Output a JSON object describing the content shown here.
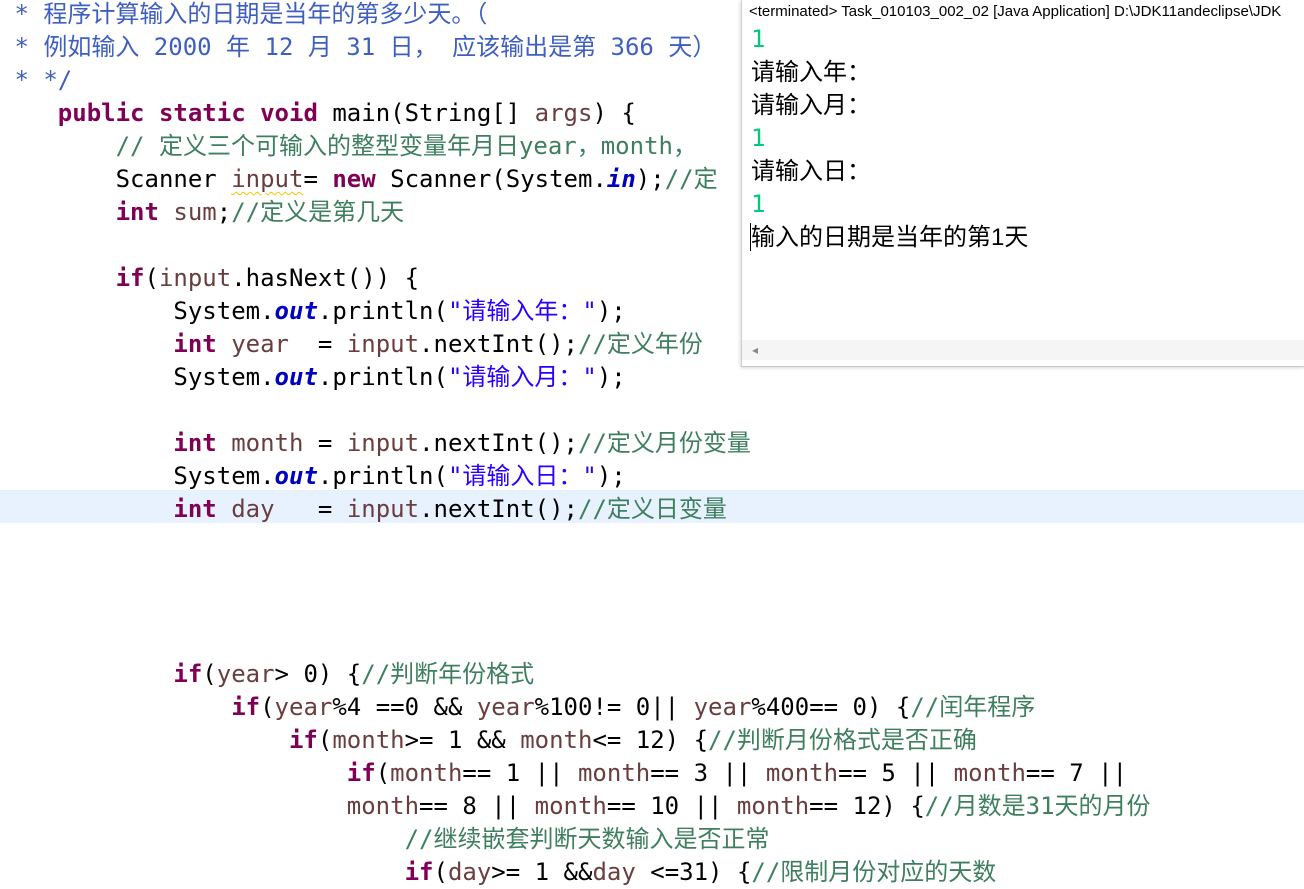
{
  "editor": {
    "lines": [
      [
        {
          "t": " * 程序计算输入的日期是当年的第多少天。（",
          "c": "javadoc"
        }
      ],
      [
        {
          "t": " * 例如输入 2000 年 12 月 31 日， 应该输出是第 366 天）",
          "c": "javadoc"
        }
      ],
      [
        {
          "t": " * */",
          "c": "javadoc"
        }
      ],
      [
        {
          "t": "    ",
          "c": ""
        },
        {
          "t": "public",
          "c": "keyword"
        },
        {
          "t": " ",
          "c": ""
        },
        {
          "t": "static",
          "c": "keyword"
        },
        {
          "t": " ",
          "c": ""
        },
        {
          "t": "void",
          "c": "keyword"
        },
        {
          "t": " main(String[] ",
          "c": ""
        },
        {
          "t": "args",
          "c": "local"
        },
        {
          "t": ") {",
          "c": ""
        }
      ],
      [
        {
          "t": "        ",
          "c": ""
        },
        {
          "t": "// 定义三个可输入的整型变量年月日year，month，",
          "c": "comment"
        }
      ],
      [
        {
          "t": "        Scanner ",
          "c": ""
        },
        {
          "t": "input",
          "c": "local warn"
        },
        {
          "t": "= ",
          "c": ""
        },
        {
          "t": "new",
          "c": "keyword"
        },
        {
          "t": " Scanner(System.",
          "c": ""
        },
        {
          "t": "in",
          "c": "field"
        },
        {
          "t": ");",
          "c": ""
        },
        {
          "t": "//定",
          "c": "comment"
        }
      ],
      [
        {
          "t": "        ",
          "c": ""
        },
        {
          "t": "int",
          "c": "keyword"
        },
        {
          "t": " ",
          "c": ""
        },
        {
          "t": "sum",
          "c": "local"
        },
        {
          "t": ";",
          "c": ""
        },
        {
          "t": "//定义是第几天",
          "c": "comment"
        }
      ],
      [
        {
          "t": "",
          "c": ""
        }
      ],
      [
        {
          "t": "        ",
          "c": ""
        },
        {
          "t": "if",
          "c": "keyword"
        },
        {
          "t": "(",
          "c": ""
        },
        {
          "t": "input",
          "c": "local"
        },
        {
          "t": ".hasNext()) {",
          "c": ""
        }
      ],
      [
        {
          "t": "            System.",
          "c": ""
        },
        {
          "t": "out",
          "c": "field"
        },
        {
          "t": ".println(",
          "c": ""
        },
        {
          "t": "\"请输入年：\"",
          "c": "string"
        },
        {
          "t": ");",
          "c": ""
        }
      ],
      [
        {
          "t": "            ",
          "c": ""
        },
        {
          "t": "int",
          "c": "keyword"
        },
        {
          "t": " ",
          "c": ""
        },
        {
          "t": "year",
          "c": "local"
        },
        {
          "t": "  = ",
          "c": ""
        },
        {
          "t": "input",
          "c": "local"
        },
        {
          "t": ".nextInt();",
          "c": ""
        },
        {
          "t": "//定义年份",
          "c": "comment"
        }
      ],
      [
        {
          "t": "            System.",
          "c": ""
        },
        {
          "t": "out",
          "c": "field"
        },
        {
          "t": ".println(",
          "c": ""
        },
        {
          "t": "\"请输入月：\"",
          "c": "string"
        },
        {
          "t": ");",
          "c": ""
        }
      ],
      [
        {
          "t": "",
          "c": ""
        }
      ],
      [
        {
          "t": "            ",
          "c": ""
        },
        {
          "t": "int",
          "c": "keyword"
        },
        {
          "t": " ",
          "c": ""
        },
        {
          "t": "month",
          "c": "local"
        },
        {
          "t": " = ",
          "c": ""
        },
        {
          "t": "input",
          "c": "local"
        },
        {
          "t": ".nextInt();",
          "c": ""
        },
        {
          "t": "//定义月份变量",
          "c": "comment"
        }
      ],
      [
        {
          "t": "            System.",
          "c": ""
        },
        {
          "t": "out",
          "c": "field"
        },
        {
          "t": ".println(",
          "c": ""
        },
        {
          "t": "\"请输入日：\"",
          "c": "string"
        },
        {
          "t": ");",
          "c": ""
        }
      ],
      [
        {
          "t": "            ",
          "c": ""
        },
        {
          "t": "int",
          "c": "keyword"
        },
        {
          "t": " ",
          "c": ""
        },
        {
          "t": "day",
          "c": "local"
        },
        {
          "t": "   = ",
          "c": ""
        },
        {
          "t": "input",
          "c": "local"
        },
        {
          "t": ".nextInt();",
          "c": ""
        },
        {
          "t": "//定义日变量",
          "c": "comment"
        }
      ],
      [
        {
          "t": "",
          "c": ""
        }
      ],
      [
        {
          "t": "",
          "c": ""
        }
      ],
      [
        {
          "t": "",
          "c": ""
        }
      ],
      [
        {
          "t": "",
          "c": ""
        }
      ],
      [
        {
          "t": "            ",
          "c": ""
        },
        {
          "t": "if",
          "c": "keyword"
        },
        {
          "t": "(",
          "c": ""
        },
        {
          "t": "year",
          "c": "local"
        },
        {
          "t": "> 0) {",
          "c": ""
        },
        {
          "t": "//判断年份格式",
          "c": "comment"
        }
      ],
      [
        {
          "t": "                ",
          "c": ""
        },
        {
          "t": "if",
          "c": "keyword"
        },
        {
          "t": "(",
          "c": ""
        },
        {
          "t": "year",
          "c": "local"
        },
        {
          "t": "%4 ==0 && ",
          "c": ""
        },
        {
          "t": "year",
          "c": "local"
        },
        {
          "t": "%100!= 0|| ",
          "c": ""
        },
        {
          "t": "year",
          "c": "local"
        },
        {
          "t": "%400== 0) {",
          "c": ""
        },
        {
          "t": "//闰年程序",
          "c": "comment"
        }
      ],
      [
        {
          "t": "                    ",
          "c": ""
        },
        {
          "t": "if",
          "c": "keyword"
        },
        {
          "t": "(",
          "c": ""
        },
        {
          "t": "month",
          "c": "local"
        },
        {
          "t": ">= 1 && ",
          "c": ""
        },
        {
          "t": "month",
          "c": "local"
        },
        {
          "t": "<= 12) {",
          "c": ""
        },
        {
          "t": "//判断月份格式是否正确",
          "c": "comment"
        }
      ],
      [
        {
          "t": "                        ",
          "c": ""
        },
        {
          "t": "if",
          "c": "keyword"
        },
        {
          "t": "(",
          "c": ""
        },
        {
          "t": "month",
          "c": "local"
        },
        {
          "t": "== 1 || ",
          "c": ""
        },
        {
          "t": "month",
          "c": "local"
        },
        {
          "t": "== 3 || ",
          "c": ""
        },
        {
          "t": "month",
          "c": "local"
        },
        {
          "t": "== 5 || ",
          "c": ""
        },
        {
          "t": "month",
          "c": "local"
        },
        {
          "t": "== 7 ||",
          "c": ""
        }
      ],
      [
        {
          "t": "                        ",
          "c": ""
        },
        {
          "t": "month",
          "c": "local"
        },
        {
          "t": "== 8 || ",
          "c": ""
        },
        {
          "t": "month",
          "c": "local"
        },
        {
          "t": "== 10 || ",
          "c": ""
        },
        {
          "t": "month",
          "c": "local"
        },
        {
          "t": "== 12) {",
          "c": ""
        },
        {
          "t": "//月数是31天的月份",
          "c": "comment"
        }
      ],
      [
        {
          "t": "                            ",
          "c": ""
        },
        {
          "t": "//继续嵌套判断天数输入是否正常",
          "c": "comment"
        }
      ],
      [
        {
          "t": "                            ",
          "c": ""
        },
        {
          "t": "if",
          "c": "keyword"
        },
        {
          "t": "(",
          "c": ""
        },
        {
          "t": "day",
          "c": "local"
        },
        {
          "t": ">= 1 &&",
          "c": ""
        },
        {
          "t": "day",
          "c": "local"
        },
        {
          "t": " <=31) {",
          "c": ""
        },
        {
          "t": "//限制月份对应的天数",
          "c": "comment"
        }
      ]
    ]
  },
  "console": {
    "title": "<terminated> Task_010103_002_02 [Java Application] D:\\JDK11andeclipse\\JDK",
    "lines": [
      {
        "text": "1",
        "kind": "input"
      },
      {
        "text": "请输入年：",
        "kind": "output"
      },
      {
        "text": "请输入月：",
        "kind": "output"
      },
      {
        "text": "1",
        "kind": "input"
      },
      {
        "text": "请输入日：",
        "kind": "output"
      },
      {
        "text": "1",
        "kind": "input"
      },
      {
        "text": "输入的日期是当年的第1天",
        "kind": "output"
      }
    ]
  },
  "icons": {
    "scroll_left": "scroll-left-arrow-icon"
  },
  "colors": {
    "keyword": "#7f0055",
    "comment": "#3f7f5f",
    "javadoc": "#3f5fbf",
    "string": "#2a00ff",
    "local_variable": "#6a3e3e",
    "static_field": "#0000c0",
    "console_input": "#00c87d",
    "current_line": "#e8f2fe"
  }
}
